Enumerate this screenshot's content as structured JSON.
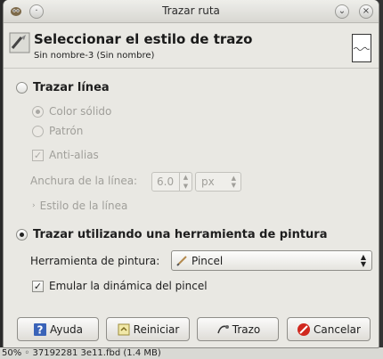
{
  "window": {
    "title": "Trazar ruta"
  },
  "header": {
    "title": "Seleccionar el estilo de trazo",
    "subtitle": "Sin nombre-3 (Sin nombre)"
  },
  "stroke_line": {
    "label": "Trazar línea",
    "selected": false,
    "solid_color_label": "Color sólido",
    "pattern_label": "Patrón",
    "antialias_label": "Anti-alias",
    "line_width_label": "Anchura de la línea:",
    "line_width_value": "6.0",
    "unit_value": "px",
    "line_style_label": "Estilo de la línea"
  },
  "paint_tool": {
    "label": "Trazar utilizando una herramienta de pintura",
    "selected": true,
    "tool_label": "Herramienta de pintura:",
    "tool_value": "Pincel",
    "emulate_label": "Emular la dinámica del pincel",
    "emulate_checked": true
  },
  "buttons": {
    "help": "Ayuda",
    "reset": "Reiniciar",
    "stroke": "Trazo",
    "cancel": "Cancelar"
  },
  "status_bar": {
    "text": "50%  ◦  37192281 3e11.fbd (1.4 MB)"
  },
  "icons": {
    "app": "gimp-icon",
    "stroke": "stroke-path-icon",
    "help": "help-icon",
    "reset": "reset-icon",
    "stroke_button": "stroke-icon",
    "cancel": "cancel-icon",
    "brush": "brush-icon"
  },
  "colors": {
    "window_bg": "#e9e8e3",
    "cancel_red": "#d0281e",
    "help_blue": "#3a63b8"
  }
}
